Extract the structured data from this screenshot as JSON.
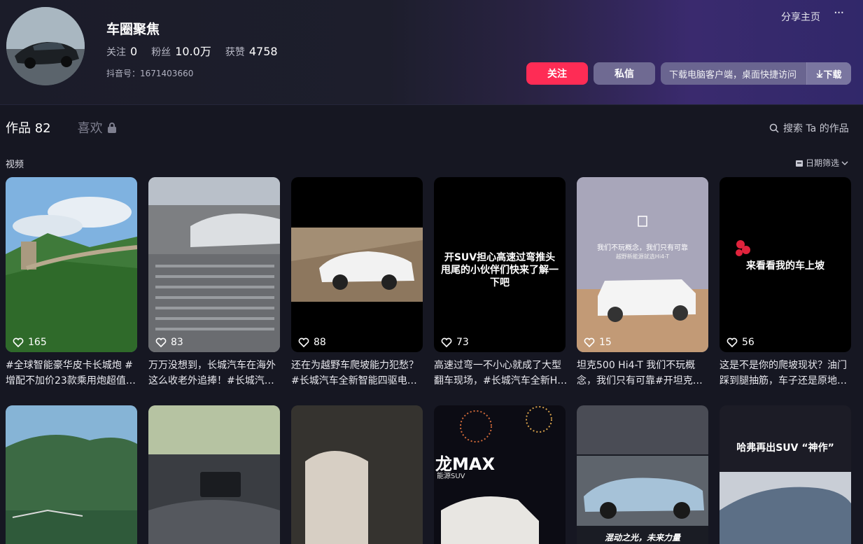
{
  "profile": {
    "name": "车圈聚焦",
    "following_label": "关注",
    "following_count": "0",
    "followers_label": "粉丝",
    "followers_count": "10.0万",
    "likes_label": "获赞",
    "likes_count": "4758",
    "douyin_id": "抖音号：1671403660"
  },
  "header": {
    "share": "分享主页",
    "more": "···",
    "follow": "关注",
    "message": "私信",
    "download_text": "下载电脑客户端，桌面快捷访问",
    "download_btn": "下载"
  },
  "tabs": {
    "works_label": "作品",
    "works_count": "82",
    "likes": "喜欢"
  },
  "search_placeholder": "搜索 Ta 的作品",
  "section_title": "视频",
  "date_filter": "日期筛选",
  "videos": [
    {
      "likes": "165",
      "desc": "#全球智能豪华皮卡长城炮 #增配不加价23款乘用炮超值…"
    },
    {
      "likes": "83",
      "desc": "万万没想到，长城汽车在海外这么收老外追捧！#长城汽…"
    },
    {
      "likes": "88",
      "desc": "还在为越野车爬坡能力犯愁？#长城汽车全新智能四驱电…"
    },
    {
      "likes": "73",
      "desc": "高速过弯一不小心就成了大型翻车现场，#长城汽车全新H…",
      "overlay": "开SUV担心高速过弯推头甩尾的小伙伴们快来了解一下吧"
    },
    {
      "likes": "15",
      "desc": "坦克500 Hi4-T 我们不玩概念，我们只有可靠#开坦克…",
      "overlay1": "我们不玩概念，我们只有可靠",
      "overlay2": "越野新能源就选Hi4-T"
    },
    {
      "likes": "56",
      "desc": "这是不是你的爬坡现状？油门踩到腿抽筋，车子还是原地…",
      "overlay": "来看看我的车上坡"
    }
  ],
  "row2": {
    "max_text": "龙MAX",
    "max_sub": "能源SUV",
    "c4_overlay": "混动之光，未来力量",
    "c6_overlay": "哈弗再出SUV “神作”"
  }
}
